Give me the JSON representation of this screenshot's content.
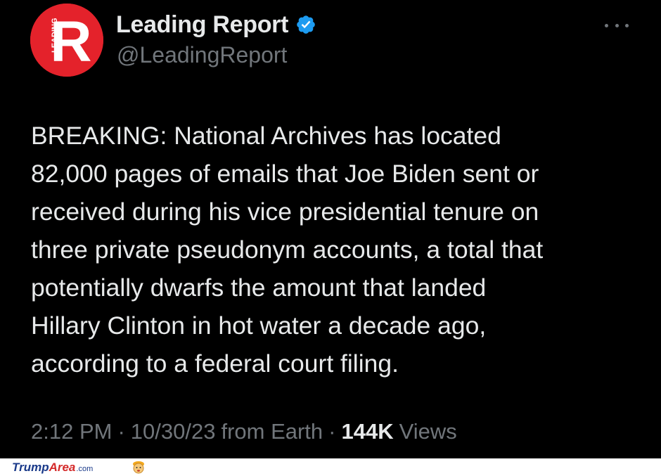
{
  "tweet": {
    "avatar_letter": "R",
    "avatar_side_text": "LEADING",
    "display_name": "Leading Report",
    "handle": "@LeadingReport",
    "body": "BREAKING: National Archives has located\n82,000 pages of emails that Joe Biden sent or\nreceived during his vice presidential tenure on\nthree private pseudonym accounts, a total that\npotentially dwarfs the amount that landed\nHillary Clinton in hot water a decade ago,\naccording to a federal court filing.",
    "time": "2:12 PM",
    "separator": "·",
    "date": "10/30/23",
    "source": "from Earth",
    "views_count": "144K",
    "views_label": "Views"
  },
  "watermark": {
    "part1": "Trump",
    "part2": "Area",
    "part3": ".com"
  },
  "colors": {
    "background": "#000000",
    "primary_text": "#e7e9ea",
    "secondary_text": "#71767b",
    "avatar": "#e4222b",
    "verified": "#1d9bf0"
  }
}
